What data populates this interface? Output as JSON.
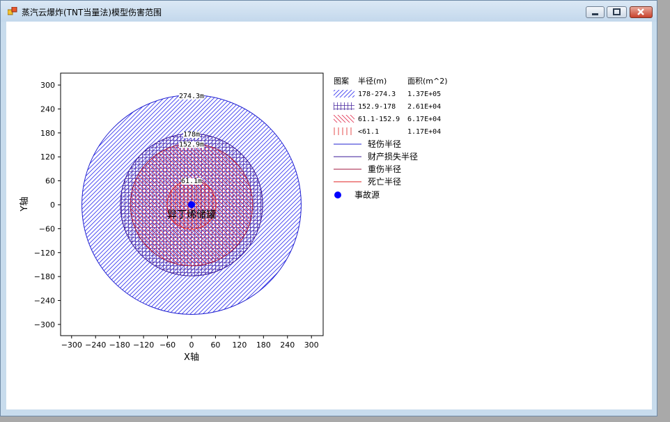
{
  "window": {
    "title": "蒸汽云爆炸(TNT当量法)模型伤害范围",
    "minimize_icon": "minimize-icon",
    "maximize_icon": "maximize-icon",
    "close_icon": "close-icon"
  },
  "chart_data": {
    "type": "circles",
    "xlabel": "X轴",
    "ylabel": "Y轴",
    "xlim": [
      -325,
      325
    ],
    "ylim": [
      -330,
      330
    ],
    "xticks": [
      -300,
      -240,
      -180,
      -120,
      -60,
      0,
      60,
      120,
      180,
      240,
      300
    ],
    "yticks": [
      300,
      240,
      180,
      120,
      60,
      0,
      -60,
      -120,
      -180,
      -240,
      -300
    ],
    "source": {
      "label": "异丁烯储罐",
      "x": 0,
      "y": 0,
      "color": "#0000ff"
    },
    "circles": [
      {
        "radius": 274.3,
        "label": "274.3m",
        "color": "#2020d0",
        "pattern": "hatch-blue"
      },
      {
        "radius": 178,
        "label": "178m",
        "color": "#3a1a9a",
        "pattern": "grid-purple"
      },
      {
        "radius": 152.9,
        "label": "152.9m",
        "color": "#a0153c",
        "pattern": "hatch-red"
      },
      {
        "radius": 61.1,
        "label": "61.1m",
        "color": "#e02020",
        "pattern": "vlines-red"
      }
    ],
    "legend": {
      "headers": [
        "图案",
        "半径(m)",
        "面积(m^2)"
      ],
      "rows": [
        {
          "range": "178-274.3",
          "area": "1.37E+05",
          "pattern": "hatch-blue"
        },
        {
          "range": "152.9-178",
          "area": "2.61E+04",
          "pattern": "grid-purple"
        },
        {
          "range": "61.1-152.9",
          "area": "6.17E+04",
          "pattern": "hatch-red"
        },
        {
          "range": "<61.1",
          "area": "1.17E+04",
          "pattern": "vlines-red"
        }
      ],
      "lines": [
        {
          "label": "轻伤半径",
          "color": "#2020d0"
        },
        {
          "label": "财产损失半径",
          "color": "#3a1a9a"
        },
        {
          "label": "重伤半径",
          "color": "#a0153c"
        },
        {
          "label": "死亡半径",
          "color": "#e02020"
        }
      ],
      "source_label": "事故源"
    }
  }
}
